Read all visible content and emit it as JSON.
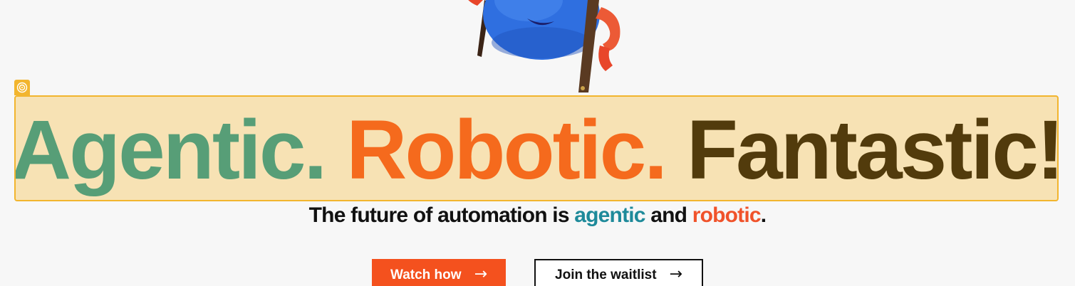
{
  "hero": {
    "headline": {
      "word1": "Agentic.",
      "word2": "Robotic.",
      "word3": "Fantastic!"
    },
    "subtitle": {
      "prefix": "The future of automation is ",
      "highlight1": "agentic",
      "middle": " and ",
      "highlight2": "robotic",
      "suffix": "."
    },
    "buttons": {
      "watch_label": "Watch how",
      "waitlist_label": "Join the waitlist",
      "arrow": "→"
    }
  },
  "selection": {
    "badge_icon": "target-icon"
  },
  "mascot": {
    "icon": "robot-mascot"
  },
  "colors": {
    "agentic_green": "#579e77",
    "robotic_orange": "#f56a1d",
    "fantastic_brown": "#523b0c",
    "subtitle_teal": "#1e8a9a",
    "subtitle_red": "#f0522a",
    "watch_button_bg": "#f4511e",
    "selection_border": "#f2b52e",
    "selection_fill": "#f7e2b4"
  }
}
